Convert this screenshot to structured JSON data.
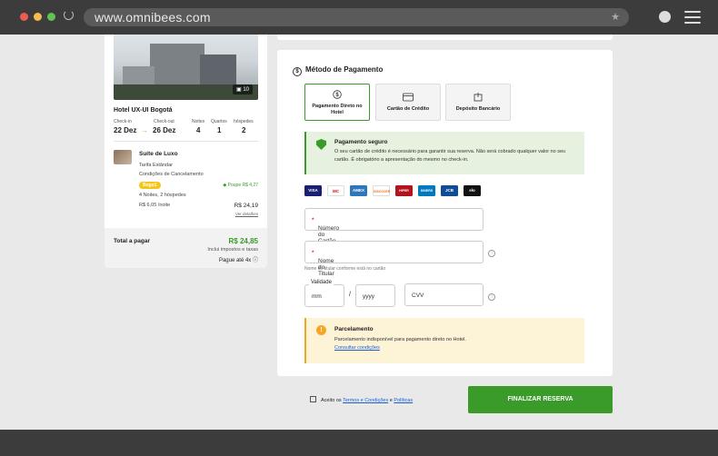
{
  "browser": {
    "url": "www.omnibees.com"
  },
  "summary": {
    "image_count": "10",
    "hotel_name": "Hotel UX-UI Bogotá",
    "labels": {
      "checkin": "Check-in",
      "checkout": "Check-out",
      "nights": "Noites",
      "rooms": "Quartos",
      "guests": "hóspedes"
    },
    "values": {
      "checkin": "22 Dez",
      "checkout": "26 Dez",
      "nights": "4",
      "rooms": "1",
      "guests": "2"
    },
    "room": {
      "title": "Suíte de Luxo",
      "rate": "Tarifa Estândar",
      "conditions": "Condições de Cancelamento",
      "badge": "Bogo1",
      "save": "Poupe R$ 4,27",
      "stay": "4 Noites, 2 hóspedes",
      "nightly": "R$ 6,05 /noite",
      "price": "R$ 24,19",
      "details": "Ver detalhes"
    },
    "total": {
      "label": "Total a pagar",
      "price": "R$ 24,85",
      "taxes": "Inclui impostos e taxas",
      "installments": "Pague até 4x"
    }
  },
  "payment": {
    "title": "Método de Pagamento",
    "options": [
      {
        "label": "Pagamento Direto no Hotel"
      },
      {
        "label": "Cartão de Crédito"
      },
      {
        "label": "Depósito Bancário"
      }
    ],
    "secure": {
      "title": "Pagamento seguro",
      "text": "O seu cartão de crédito é necessário para garantir sua reserva. Não será cobrado qualquer valor no seu cartão. É obrigatório a apresentação do mesmo no check-in."
    },
    "card_brands": [
      "VISA",
      "MC",
      "AMEX",
      "DISCOVER",
      "HIPER",
      "DINERS",
      "JCB",
      "elo"
    ],
    "fields": {
      "card_number": "Número do Cartão",
      "holder": "Nome do Titular",
      "holder_hint": "Nome do titular conforme está no cartão",
      "validity": "Validade",
      "month": "mm",
      "slash": "/",
      "year": "yyyy",
      "cvv": "CVV"
    },
    "installments": {
      "title": "Parcelamento",
      "text": "Parcelamento indisponível para pagamento direto no Hotel.",
      "link": "Consultar condições"
    }
  },
  "footer": {
    "terms_prefix": "Aceito os",
    "terms_link": "Termos e Condições",
    "terms_and": "e",
    "policies_link": "Políticas",
    "finalize": "FINALIZAR RESERVA"
  },
  "colors": {
    "accent": "#3a9a2a",
    "warning": "#f5a623",
    "link": "#1a5fd1"
  }
}
